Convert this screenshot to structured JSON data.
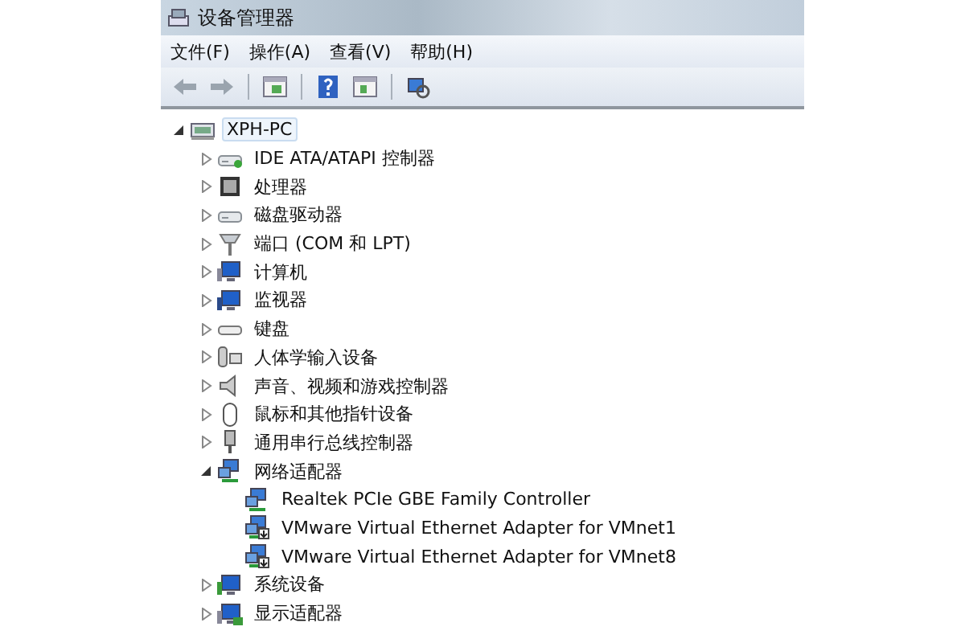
{
  "window": {
    "title": "设备管理器"
  },
  "menu": [
    "文件(F)",
    "操作(A)",
    "查看(V)",
    "帮助(H)"
  ],
  "tree": {
    "label": "XPH-PC",
    "expanded": true,
    "selected": true,
    "children": [
      {
        "label": "IDE ATA/ATAPI 控制器",
        "expanded": false,
        "selected": false
      },
      {
        "label": "处理器",
        "expanded": false,
        "selected": false
      },
      {
        "label": "磁盘驱动器",
        "expanded": false,
        "selected": false
      },
      {
        "label": "端口 (COM 和 LPT)",
        "expanded": false,
        "selected": false
      },
      {
        "label": "计算机",
        "expanded": false,
        "selected": false
      },
      {
        "label": "监视器",
        "expanded": false,
        "selected": false
      },
      {
        "label": "键盘",
        "expanded": false,
        "selected": false
      },
      {
        "label": "人体学输入设备",
        "expanded": false,
        "selected": false
      },
      {
        "label": "声音、视频和游戏控制器",
        "expanded": false,
        "selected": false
      },
      {
        "label": "鼠标和其他指针设备",
        "expanded": false,
        "selected": false
      },
      {
        "label": "通用串行总线控制器",
        "expanded": false,
        "selected": false
      },
      {
        "label": "网络适配器",
        "expanded": true,
        "selected": false,
        "children": [
          {
            "label": "Realtek PCIe GBE Family Controller",
            "selected": false
          },
          {
            "label": "VMware Virtual Ethernet Adapter for VMnet1",
            "selected": false
          },
          {
            "label": "VMware Virtual Ethernet Adapter for VMnet8",
            "selected": false
          }
        ]
      },
      {
        "label": "系统设备",
        "expanded": false,
        "selected": false
      },
      {
        "label": "显示适配器",
        "expanded": false,
        "selected": false
      }
    ]
  }
}
